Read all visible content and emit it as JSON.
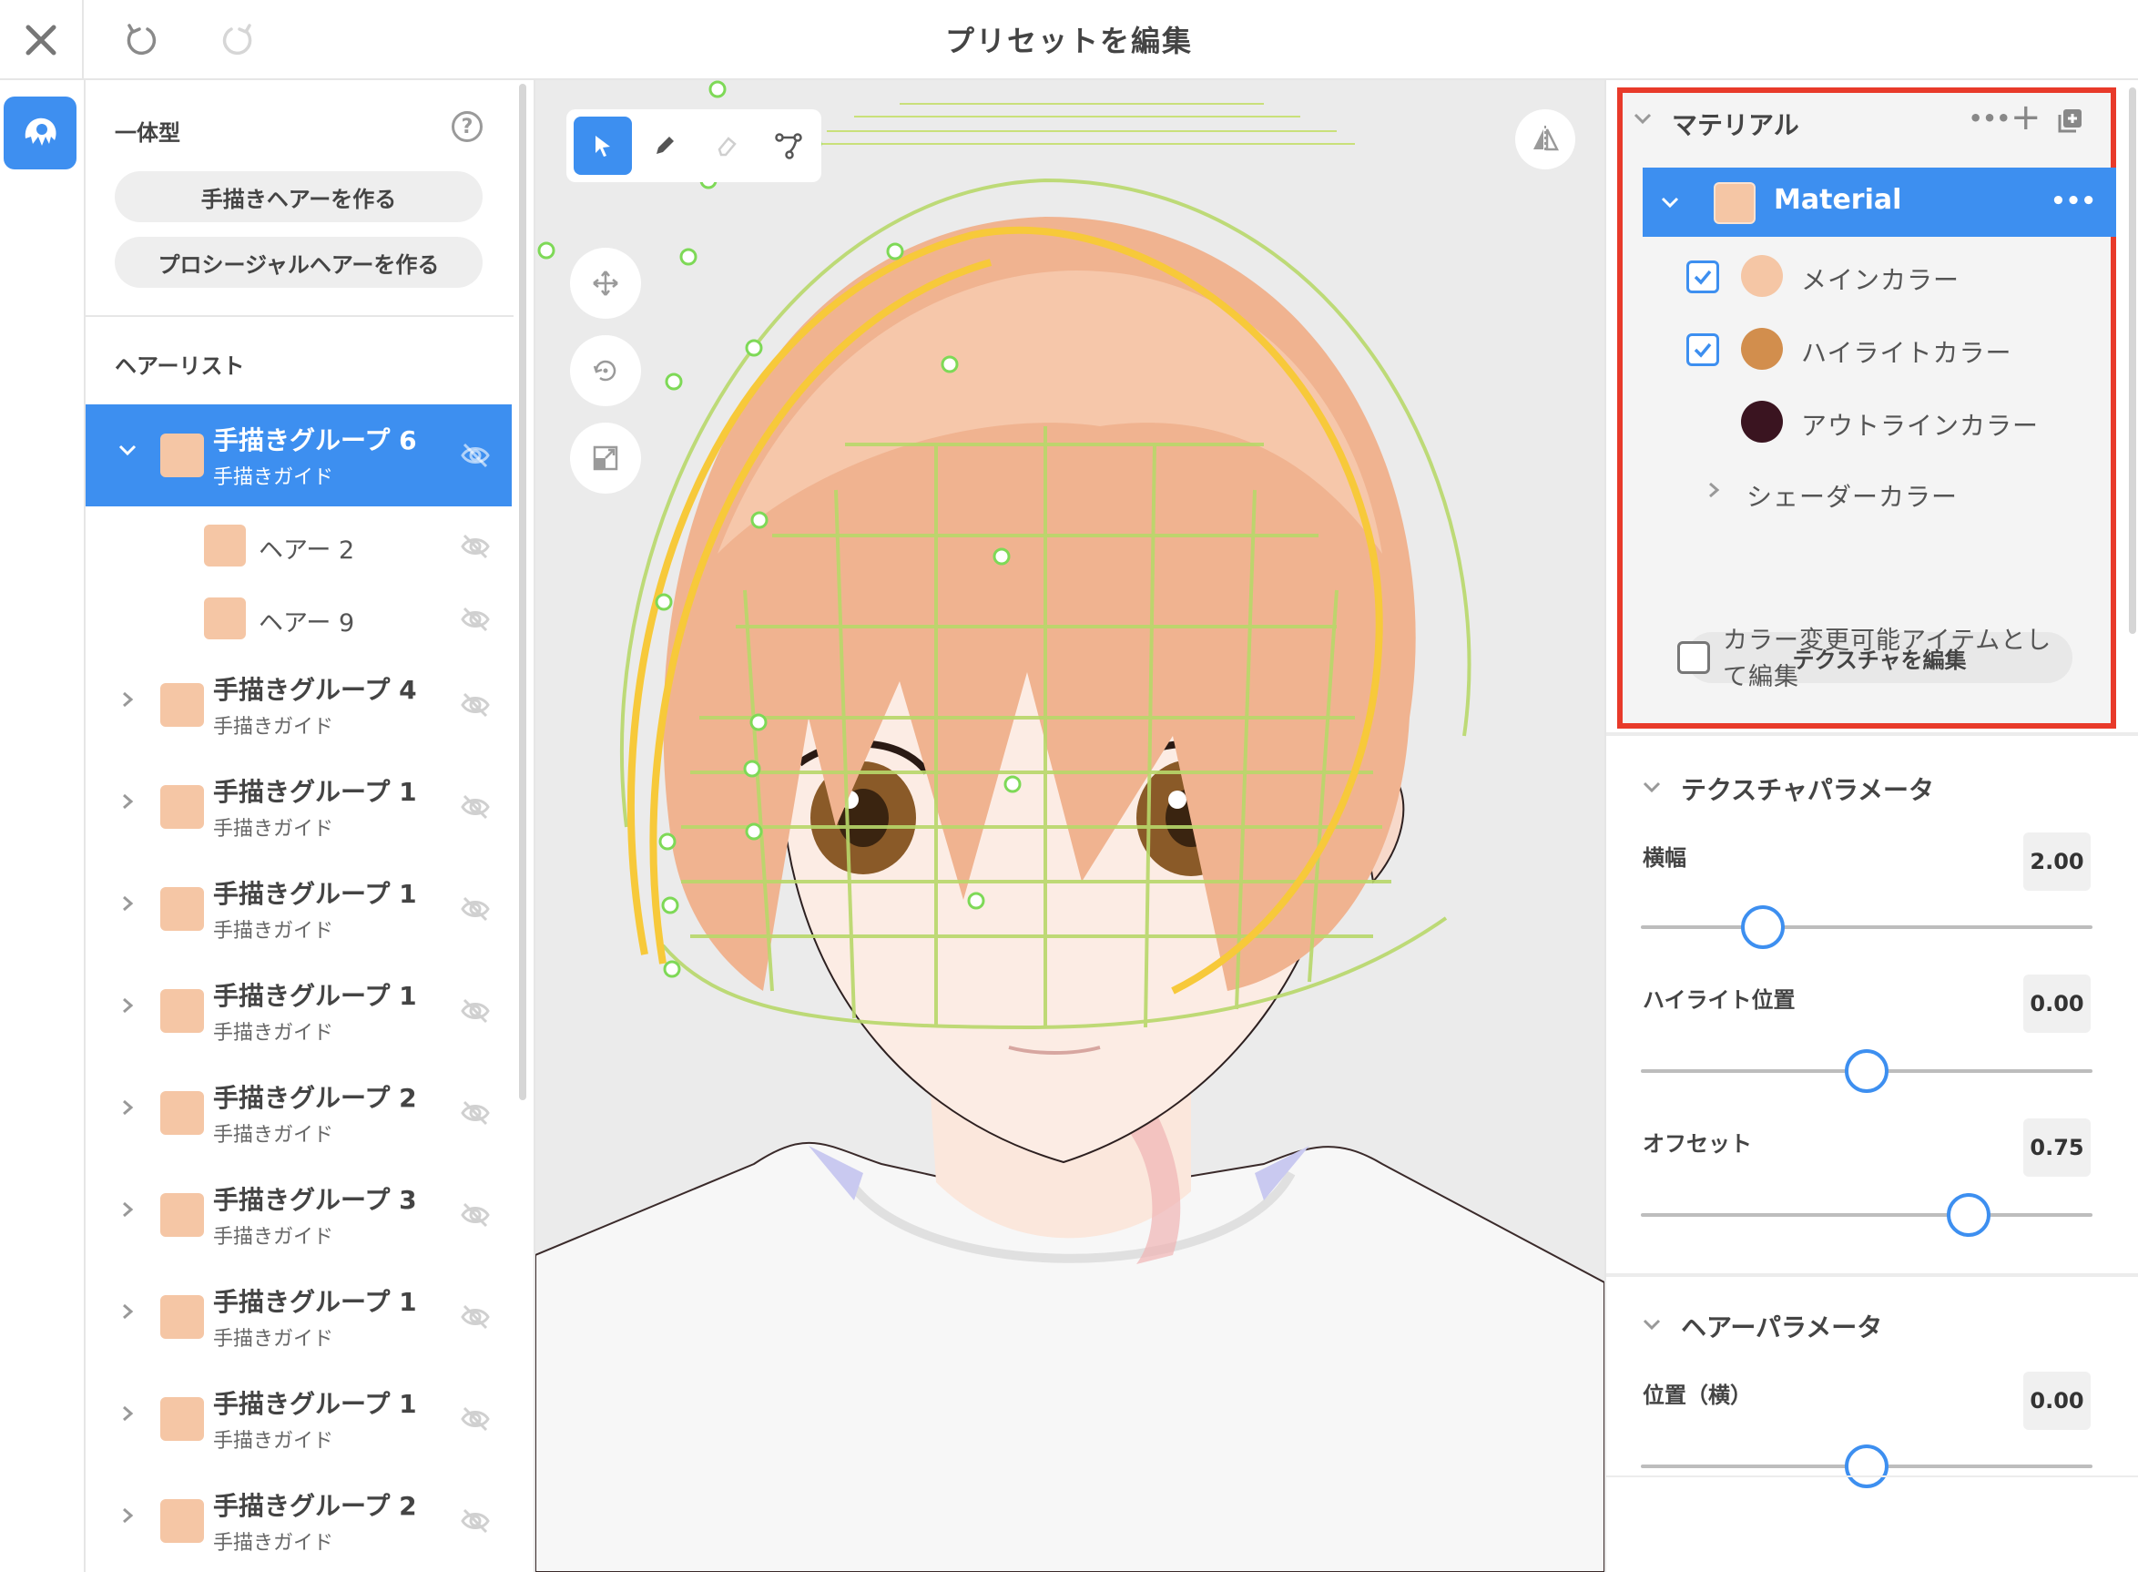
{
  "window": {
    "title": "プリセットを編集"
  },
  "hair_panel": {
    "type_label": "一体型",
    "help_label": "?",
    "buttons": {
      "hand_drawn": "手描きヘアーを作る",
      "procedural": "プロシージャルヘアーを作る"
    },
    "list_label": "ヘアーリスト",
    "selected_group": {
      "title": "手描きグループ 6",
      "subtitle": "手描きガイド",
      "children": [
        {
          "label": "ヘアー 2"
        },
        {
          "label": "ヘアー 9"
        }
      ]
    },
    "groups": [
      {
        "title": "手描きグループ 4",
        "subtitle": "手描きガイド"
      },
      {
        "title": "手描きグループ 1",
        "subtitle": "手描きガイド"
      },
      {
        "title": "手描きグループ 1",
        "subtitle": "手描きガイド"
      },
      {
        "title": "手描きグループ 1",
        "subtitle": "手描きガイド"
      },
      {
        "title": "手描きグループ 2",
        "subtitle": "手描きガイド"
      },
      {
        "title": "手描きグループ 3",
        "subtitle": "手描きガイド"
      },
      {
        "title": "手描きグループ 1",
        "subtitle": "手描きガイド"
      },
      {
        "title": "手描きグループ 1",
        "subtitle": "手描きガイド"
      },
      {
        "title": "手描きグループ 2",
        "subtitle": "手描きガイド"
      }
    ]
  },
  "material_panel": {
    "header": "マテリアル",
    "more_label": "•••",
    "add_label": "+",
    "material_name": "Material",
    "colors": [
      {
        "label": "メインカラー",
        "checked": true,
        "color": "#f5c6a5"
      },
      {
        "label": "ハイライトカラー",
        "checked": true,
        "color": "#d28e4d"
      },
      {
        "label": "アウトラインカラー",
        "checked": false,
        "color": "#3a1420"
      }
    ],
    "shader_label": "シェーダーカラー",
    "edit_texture": "テクスチャを編集",
    "color_change_label_1": "カラー変更可能アイテムとし",
    "color_change_label_2": "て編集"
  },
  "texture_params": {
    "header": "テクスチャパラメータ",
    "width_label": "横幅",
    "width_value": "2.00",
    "width_fraction": 0.27,
    "highlight_label": "ハイライト位置",
    "highlight_value": "0.00",
    "highlight_fraction": 0.5,
    "offset_label": "オフセット",
    "offset_value": "0.75",
    "offset_fraction": 0.725
  },
  "hair_params": {
    "header": "ヘアーパラメータ",
    "pos_x_label": "位置（横）",
    "pos_x_value": "0.00",
    "pos_x_fraction": 0.5
  },
  "colors": {
    "accent": "#3d8ff0",
    "hair": "#f5c6a5",
    "highlight_box": "#e83a2a",
    "guide_wire": "#b8d86a",
    "guide_yellow": "#f7c93a"
  }
}
